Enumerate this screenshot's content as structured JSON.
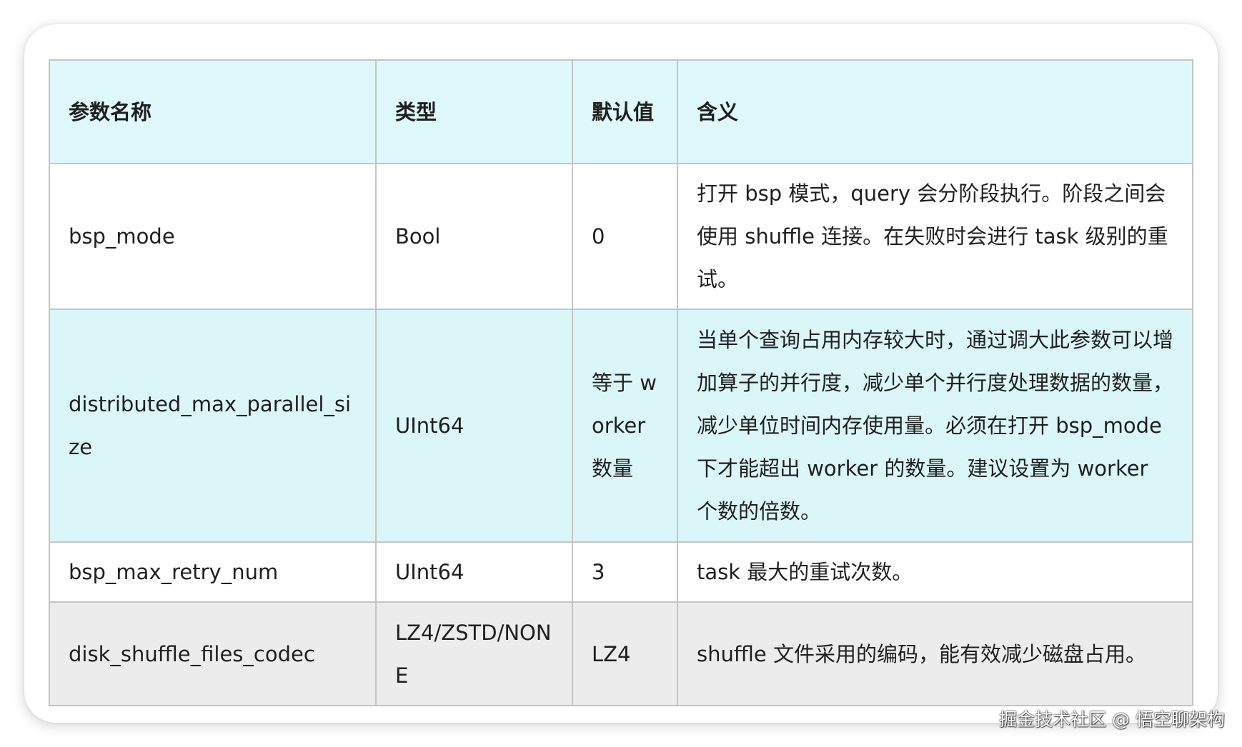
{
  "table": {
    "headers": [
      "参数名称",
      "类型",
      "默认值",
      "含义"
    ],
    "rows": [
      {
        "name": "bsp_mode",
        "type": "Bool",
        "default": "0",
        "meaning": "打开 bsp 模式，query 会分阶段执行。阶段之间会使用 shuffle 连接。在失败时会进行 task 级别的重试。"
      },
      {
        "name": "distributed_max_parallel_size",
        "type": "UInt64",
        "default": "等于 worker 数量",
        "meaning": "当单个查询占用内存较大时，通过调大此参数可以增加算子的并行度，减少单个并行度处理数据的数量，减少单位时间内存使用量。必须在打开 bsp_mode 下才能超出 worker 的数量。建议设置为 worker 个数的倍数。"
      },
      {
        "name": "bsp_max_retry_num",
        "type": "UInt64",
        "default": "3",
        "meaning": "task 最大的重试次数。"
      },
      {
        "name": "disk_shuffle_files_codec",
        "type": "LZ4/ZSTD/NONE",
        "default": "LZ4",
        "meaning": "shuffle 文件采用的编码，能有效减少磁盘占用。"
      }
    ]
  },
  "watermark": "掘金技术社区 @ 悟空聊架构"
}
